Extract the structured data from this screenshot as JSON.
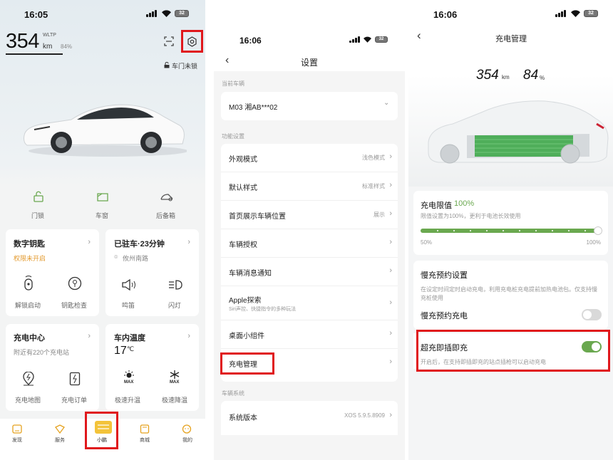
{
  "s1": {
    "time": "16:05",
    "battery": "32",
    "range_value": "354",
    "range_unit": "km",
    "range_standard": "WLTP",
    "battery_pct": "84%",
    "lock_status": "车门未锁",
    "controls": [
      "门锁",
      "车窗",
      "后备箱"
    ],
    "digital_key": {
      "title": "数字钥匙",
      "sub": "权限未开启",
      "actions": [
        "解锁启动",
        "钥匙检查"
      ]
    },
    "parked": {
      "title": "已驻车·23分钟",
      "sub": "攸州南路",
      "actions": [
        "鸣笛",
        "闪灯"
      ]
    },
    "charging": {
      "title": "充电中心",
      "sub": "附近有220个充电站",
      "actions": [
        "充电地图",
        "充电订单"
      ]
    },
    "temp": {
      "title": "车内温度",
      "value": "17",
      "unit": "℃",
      "actions": [
        "极速升温",
        "极速降温"
      ],
      "max": "MAX"
    },
    "nav": [
      "发现",
      "服务",
      "小鹏",
      "商城",
      "我的"
    ]
  },
  "s2": {
    "time": "16:06",
    "battery": "32",
    "title": "设置",
    "section_current": "当前车辆",
    "vehicle": "M03 湘AB***02",
    "section_func": "功能设置",
    "rows": [
      {
        "label": "外观模式",
        "value": "浅色模式"
      },
      {
        "label": "默认样式",
        "value": "标准样式"
      },
      {
        "label": "首页展示车辆位置",
        "value": "展示"
      },
      {
        "label": "车辆授权",
        "value": ""
      },
      {
        "label": "车辆消息通知",
        "value": ""
      },
      {
        "label": "Apple探索",
        "sub": "Siri声控、快捷指令的多种玩法",
        "value": ""
      },
      {
        "label": "桌面小组件",
        "value": ""
      },
      {
        "label": "充电管理",
        "value": ""
      }
    ],
    "section_sys": "车辆系统",
    "sys_row": {
      "label": "系统版本",
      "value": "XOS 5.9.5.8909"
    }
  },
  "s3": {
    "time": "16:06",
    "battery": "32",
    "title": "充电管理",
    "range_value": "354",
    "range_unit": "km",
    "pct_value": "84",
    "pct_unit": "%",
    "limit": {
      "title": "充电限值",
      "value": "100%",
      "desc": "限值设置为100%，更利于电池长效使用",
      "min_label": "50%",
      "max_label": "100%",
      "level": 1.0
    },
    "slow_section": "慢充预约设置",
    "slow_desc": "在设定时间定时启动充电，利用充电桩充电提前加热电池包。仅支持慢充桩使用",
    "slow_label": "慢充预约充电",
    "slow_on": false,
    "super_label": "超充即插即充",
    "super_desc": "开启后，在支持即插即充的站点插枪可以启动充电",
    "super_on": true,
    "accent": "#6aa84f"
  }
}
